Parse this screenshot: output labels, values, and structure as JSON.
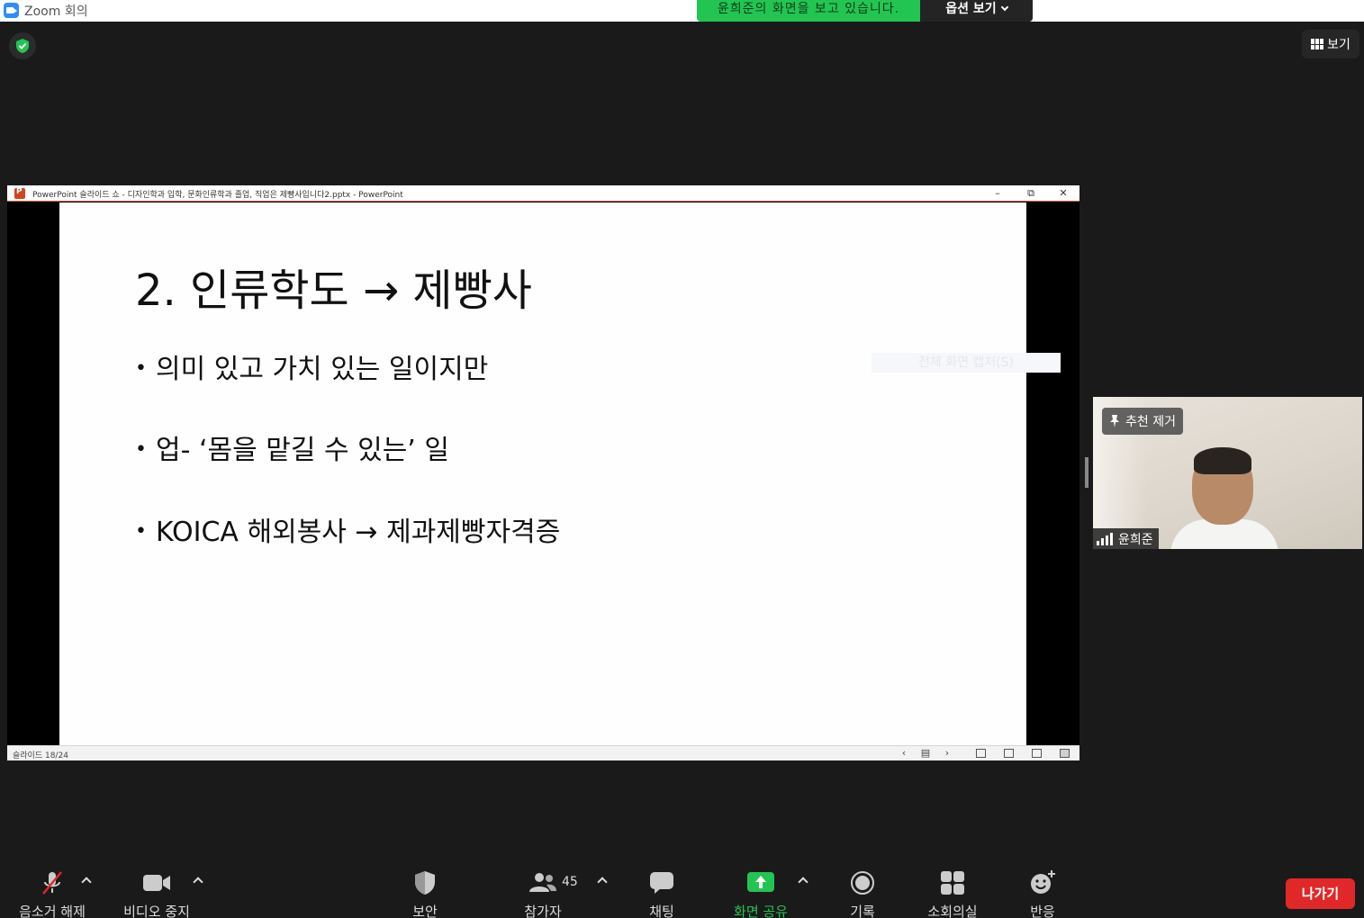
{
  "window": {
    "title": "Zoom 회의"
  },
  "share_banner": {
    "viewing_text": "윤희준의 화면을 보고 있습니다.",
    "options_label": "옵션 보기"
  },
  "view_button": {
    "label": "보기"
  },
  "powerpoint": {
    "title": "PowerPoint 슬라이드 쇼  -  디자인학과 입학, 문화인류학과 졸업, 직업은 제빵사입니다2.pptx - PowerPoint",
    "controls": {
      "minimize": "–",
      "restore": "⧉",
      "close": "✕"
    },
    "slide": {
      "title": "2. 인류학도 → 제빵사",
      "bullets": [
        "의미 있고 가치 있는 일이지만",
        "업- ‘몸을 맡길 수 있는’ 일",
        "KOICA 해외봉사 → 제과제빵자격증"
      ],
      "capture_hint": "전체 화면 캡처(S)"
    },
    "status": {
      "slide_counter": "슬라이드 18/24"
    }
  },
  "participant": {
    "unpin_label": "추천 제거",
    "name": "윤희준"
  },
  "toolbar": {
    "unmute": "음소거 해제",
    "stop_video": "비디오 중지",
    "security": "보안",
    "participants": "참가자",
    "participants_count": "45",
    "chat": "채팅",
    "share_screen": "화면 공유",
    "record": "기록",
    "breakout": "소회의실",
    "reactions": "반응",
    "leave": "나가기"
  },
  "colors": {
    "share_green": "#23c552",
    "leave_red": "#e02828",
    "zoom_blue": "#2d8cff",
    "ppt_accent": "#d04423"
  }
}
